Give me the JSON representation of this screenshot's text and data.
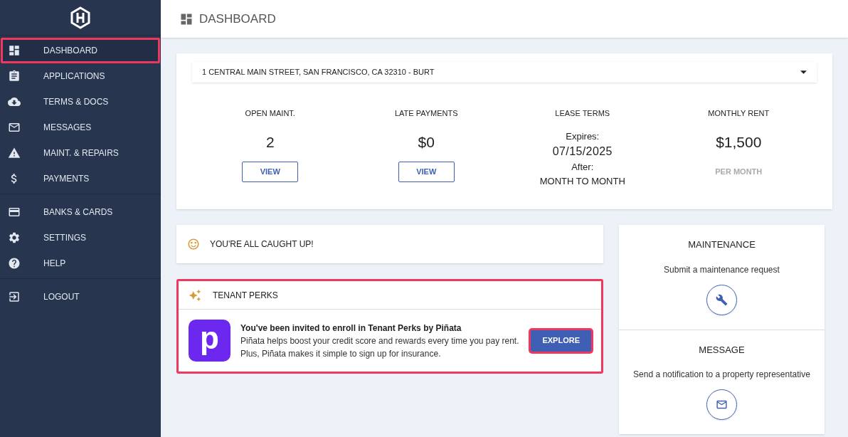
{
  "header": {
    "title": "DASHBOARD"
  },
  "sidebar": {
    "groups": [
      [
        {
          "label": "DASHBOARD",
          "kind": "dashboard",
          "selected": true
        },
        {
          "label": "APPLICATIONS",
          "kind": "clipboard",
          "selected": false
        },
        {
          "label": "TERMS & DOCS",
          "kind": "cloud",
          "selected": false
        },
        {
          "label": "MESSAGES",
          "kind": "mail",
          "selected": false
        },
        {
          "label": "MAINT. & REPAIRS",
          "kind": "warning",
          "selected": false
        },
        {
          "label": "PAYMENTS",
          "kind": "dollar",
          "selected": false
        }
      ],
      [
        {
          "label": "BANKS & CARDS",
          "kind": "card",
          "selected": false
        },
        {
          "label": "SETTINGS",
          "kind": "gear",
          "selected": false
        },
        {
          "label": "HELP",
          "kind": "help",
          "selected": false
        }
      ],
      [
        {
          "label": "LOGOUT",
          "kind": "logout",
          "selected": false
        }
      ]
    ]
  },
  "property": {
    "value": "1 CENTRAL MAIN STREET, SAN FRANCISCO, CA 32310 - BURT"
  },
  "stats": [
    {
      "kind": "button",
      "label": "OPEN MAINT.",
      "value": "2",
      "action": "VIEW"
    },
    {
      "kind": "button",
      "label": "LATE PAYMENTS",
      "value": "$0",
      "action": "VIEW"
    },
    {
      "kind": "lease",
      "label": "LEASE TERMS",
      "lines": [
        "Expires:",
        "07/15/2025",
        "After:",
        "MONTH TO MONTH"
      ]
    },
    {
      "kind": "note",
      "label": "MONTHLY RENT",
      "value": "$1,500",
      "note": "PER MONTH"
    }
  ],
  "status": {
    "text": "YOU'RE ALL CAUGHT UP!"
  },
  "perks": {
    "title": "TENANT PERKS",
    "highlighted": true,
    "logo": "p",
    "heading": "You've been invited to enroll in Tenant Perks by Piñata",
    "body": "Piñata helps boost your credit score and rewards every time you pay rent.\nPlus, Piñata makes it simple to sign up for insurance.",
    "button": {
      "label": "EXPLORE",
      "highlighted": true
    }
  },
  "actions": [
    {
      "title": "MAINTENANCE",
      "text": "Submit a maintenance request",
      "kind": "wrench"
    },
    {
      "title": "MESSAGE",
      "text": "Send a notification to a property representative",
      "kind": "mail"
    }
  ]
}
